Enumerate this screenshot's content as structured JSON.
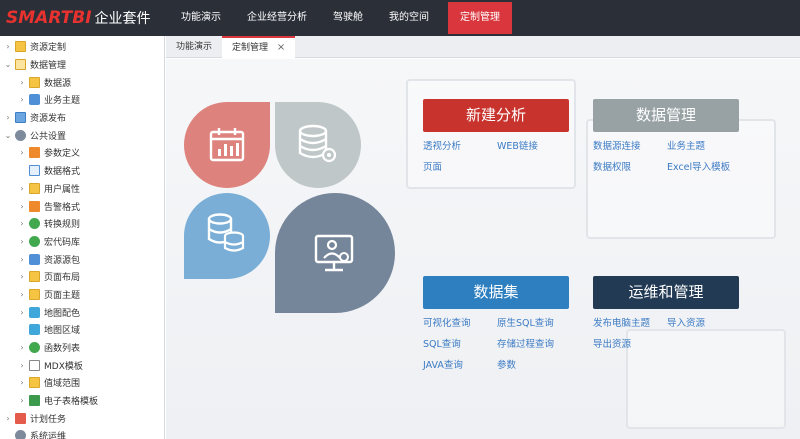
{
  "logo": {
    "brand": "SMARTBI",
    "suffix": "企业套件"
  },
  "nav": {
    "items": [
      {
        "label": "功能演示"
      },
      {
        "label": "企业经营分析"
      },
      {
        "label": "驾驶舱"
      },
      {
        "label": "我的空间"
      },
      {
        "label": "定制管理"
      }
    ]
  },
  "sidebar": {
    "items": [
      {
        "label": "资源定制",
        "caret": "›"
      },
      {
        "label": "数据管理",
        "caret": "⌄"
      },
      {
        "label": "数据源",
        "caret": "›"
      },
      {
        "label": "业务主题",
        "caret": "›"
      },
      {
        "label": "资源发布",
        "caret": "›"
      },
      {
        "label": "公共设置",
        "caret": "⌄"
      },
      {
        "label": "参数定义",
        "caret": "›"
      },
      {
        "label": "数据格式",
        "caret": ""
      },
      {
        "label": "用户属性",
        "caret": "›"
      },
      {
        "label": "告警格式",
        "caret": "›"
      },
      {
        "label": "转换规则",
        "caret": "›"
      },
      {
        "label": "宏代码库",
        "caret": "›"
      },
      {
        "label": "资源源包",
        "caret": "›"
      },
      {
        "label": "页面布局",
        "caret": "›"
      },
      {
        "label": "页面主题",
        "caret": "›"
      },
      {
        "label": "地图配色",
        "caret": "›"
      },
      {
        "label": "地图区域",
        "caret": ""
      },
      {
        "label": "函数列表",
        "caret": "›"
      },
      {
        "label": "MDX模板",
        "caret": "›"
      },
      {
        "label": "值域范围",
        "caret": "›"
      },
      {
        "label": "电子表格模板",
        "caret": "›"
      },
      {
        "label": "计划任务",
        "caret": "›"
      },
      {
        "label": "系统运维",
        "caret": ""
      }
    ]
  },
  "tabs": {
    "items": [
      {
        "label": "功能演示"
      },
      {
        "label": "定制管理",
        "close": "×"
      }
    ]
  },
  "categories": {
    "new_analysis": {
      "title": "新建分析",
      "color": "#c8332d",
      "links": [
        "透视分析",
        "WEB链接",
        "页面"
      ]
    },
    "data_mgmt": {
      "title": "数据管理",
      "color": "#98a2a5",
      "links": [
        "数据源连接",
        "业务主题",
        "数据权限",
        "Excel导入模板"
      ]
    },
    "dataset": {
      "title": "数据集",
      "color": "#2e7fc0",
      "links": [
        "可视化查询",
        "原生SQL查询",
        "SQL查询",
        "存储过程查询",
        "JAVA查询",
        "参数"
      ]
    },
    "ops": {
      "title": "运维和管理",
      "color": "#233a55",
      "links": [
        "发布电脑主题",
        "导入资源",
        "导出资源"
      ]
    }
  }
}
